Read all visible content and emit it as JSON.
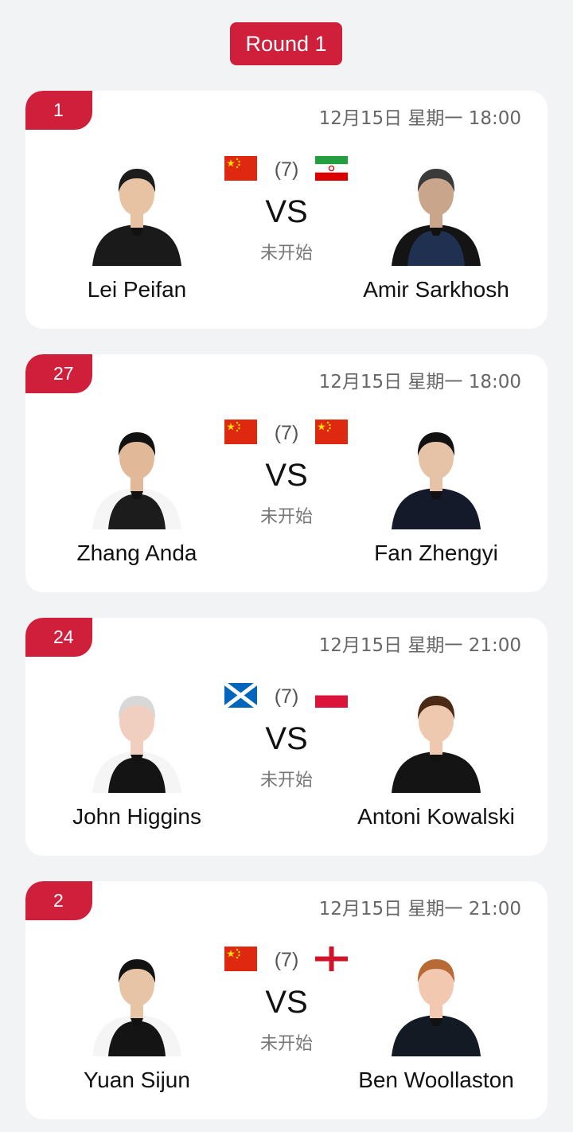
{
  "round": {
    "label": "Round 1"
  },
  "matches": [
    {
      "seed": "1",
      "datetime": "12月15日 星期一 18:00",
      "best_of": "(7)",
      "vs": "VS",
      "status": "未开始",
      "left": {
        "name": "Lei Peifan",
        "flag": "china-flag-icon"
      },
      "right": {
        "name": "Amir Sarkhosh",
        "flag": "iran-flag-icon"
      }
    },
    {
      "seed": "27",
      "datetime": "12月15日 星期一 18:00",
      "best_of": "(7)",
      "vs": "VS",
      "status": "未开始",
      "left": {
        "name": "Zhang Anda",
        "flag": "china-flag-icon"
      },
      "right": {
        "name": "Fan Zhengyi",
        "flag": "china-flag-icon"
      }
    },
    {
      "seed": "24",
      "datetime": "12月15日 星期一 21:00",
      "best_of": "(7)",
      "vs": "VS",
      "status": "未开始",
      "left": {
        "name": "John Higgins",
        "flag": "scotland-flag-icon"
      },
      "right": {
        "name": "Antoni Kowalski",
        "flag": "poland-flag-icon"
      }
    },
    {
      "seed": "2",
      "datetime": "12月15日 星期一 21:00",
      "best_of": "(7)",
      "vs": "VS",
      "status": "未开始",
      "left": {
        "name": "Yuan Sijun",
        "flag": "china-flag-icon"
      },
      "right": {
        "name": "Ben Woollaston",
        "flag": "england-flag-icon"
      }
    }
  ],
  "colors": {
    "accent": "#cf1f3a",
    "background": "#f2f3f5",
    "card": "#ffffff"
  }
}
